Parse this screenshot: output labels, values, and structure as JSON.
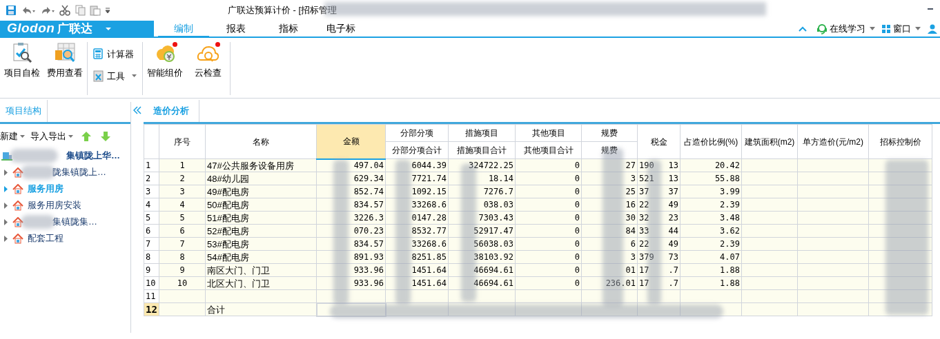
{
  "window": {
    "title": "广联达预算计价 - [招标管理"
  },
  "brand": {
    "logo": "Glodon",
    "name": "广联达"
  },
  "menu_tabs": [
    {
      "label": "编制",
      "selected": true
    },
    {
      "label": "报表",
      "selected": false
    },
    {
      "label": "指标",
      "selected": false
    },
    {
      "label": "电子标",
      "selected": false
    }
  ],
  "top_right": {
    "learning": "在线学习",
    "window_menu": "窗口"
  },
  "ribbon": [
    {
      "kind": "large",
      "items": [
        {
          "label": "项目自检",
          "notification": false
        },
        {
          "label": "费用查看",
          "notification": false
        }
      ]
    },
    {
      "kind": "small",
      "items": [
        {
          "label": "计算器",
          "dropdown": false
        },
        {
          "label": "工具",
          "dropdown": true
        }
      ]
    },
    {
      "kind": "large",
      "items": [
        {
          "label": "智能组价",
          "notification": true
        },
        {
          "label": "云检查",
          "notification": true
        }
      ]
    }
  ],
  "left_panel": {
    "tab": "项目结构",
    "toolbar": [
      "新建",
      "导入导出"
    ],
    "tree": [
      {
        "label": "集镇陇上华…",
        "kind": "root",
        "children": [
          {
            "label": "陇集镇陇上…",
            "selected": false,
            "expanded": false,
            "redacted": true
          },
          {
            "label": "服务用房",
            "selected": true,
            "expanded": false,
            "redacted": false
          },
          {
            "label": "服务用房安装",
            "selected": false,
            "expanded": false,
            "redacted": false
          },
          {
            "label": "集镇陇集…",
            "selected": false,
            "expanded": false,
            "redacted": true
          },
          {
            "label": "配套工程",
            "selected": false,
            "expanded": false,
            "redacted": false
          }
        ]
      }
    ]
  },
  "content_tab": "造价分析",
  "table": {
    "columns": [
      {
        "selected": false
      },
      {
        "label": "序号",
        "selected": false
      },
      {
        "label": "名称",
        "selected": false
      },
      {
        "label": "金额",
        "selected": true
      },
      {
        "group": "分部分项",
        "label": "分部分项合计",
        "selected": false
      },
      {
        "group": "措施项目",
        "label": "措施项目合计",
        "selected": false
      },
      {
        "group": "其他项目",
        "label": "其他项目合计",
        "selected": false
      },
      {
        "group": "规费",
        "label": "规费",
        "selected": false
      },
      {
        "label": "税金",
        "selected": false
      },
      {
        "label": "占造价比例(%)",
        "selected": false
      },
      {
        "label": "建筑面积(m2)",
        "selected": false
      },
      {
        "label": "单方造价(元/m2)",
        "selected": false
      },
      {
        "label": "招标控制价",
        "selected": false
      }
    ],
    "rows": [
      {
        "selected": false,
        "cells": [
          "1",
          "1",
          "47#公共服务设备用房",
          "497.04",
          "6044.39",
          "324722.25",
          "0",
          "27",
          [
            "190",
            "13"
          ],
          "20.42",
          "",
          "",
          ""
        ]
      },
      {
        "selected": false,
        "cells": [
          "2",
          "2",
          "48#幼儿园",
          "629.34",
          "7721.74",
          "18.14",
          "0",
          "3",
          [
            "521",
            "13"
          ],
          "55.88",
          "",
          "",
          ""
        ]
      },
      {
        "selected": false,
        "cells": [
          "3",
          "3",
          "49#配电房",
          "852.74",
          "1092.15",
          "7276.7",
          "0",
          "25",
          [
            "37",
            "37"
          ],
          "3.99",
          "",
          "",
          ""
        ]
      },
      {
        "selected": false,
        "cells": [
          "4",
          "4",
          "50#配电房",
          "834.57",
          "33268.6",
          "038.03",
          "0",
          "16",
          [
            "22",
            "49"
          ],
          "2.39",
          "",
          "",
          ""
        ]
      },
      {
        "selected": false,
        "cells": [
          "5",
          "5",
          "51#配电房",
          "3226.3",
          "0147.28",
          "7303.43",
          "0",
          "30",
          [
            "32",
            "23"
          ],
          "3.48",
          "",
          "",
          ""
        ]
      },
      {
        "selected": false,
        "cells": [
          "6",
          "6",
          "52#配电房",
          "070.23",
          "8532.77",
          "52917.47",
          "0",
          "84",
          [
            "33",
            "44"
          ],
          "3.62",
          "",
          "",
          ""
        ]
      },
      {
        "selected": false,
        "cells": [
          "7",
          "7",
          "53#配电房",
          "834.57",
          "33268.6",
          "56038.03",
          "0",
          "6",
          [
            "22",
            "49"
          ],
          "2.39",
          "",
          "",
          ""
        ]
      },
      {
        "selected": false,
        "cells": [
          "8",
          "8",
          "54#配电房",
          "891.93",
          "8251.85",
          "38103.92",
          "0",
          "3",
          [
            "379",
            "73"
          ],
          "4.07",
          "",
          "",
          ""
        ]
      },
      {
        "selected": false,
        "cells": [
          "9",
          "9",
          "南区大门、门卫",
          "933.96",
          "1451.64",
          "46694.61",
          "0",
          "01",
          [
            "17",
            ".7"
          ],
          "1.88",
          "",
          "",
          ""
        ]
      },
      {
        "selected": false,
        "cells": [
          "10",
          "10",
          "北区大门、门卫",
          "933.96",
          "1451.64",
          "46694.61",
          "0",
          "236.01",
          [
            "17",
            ".7"
          ],
          "1.88",
          "",
          "",
          ""
        ]
      },
      {
        "selected": false,
        "cells": [
          "11",
          "",
          "",
          "",
          "",
          "",
          "",
          "",
          "",
          "",
          "",
          "",
          ""
        ]
      },
      {
        "selected": true,
        "cells": [
          "12",
          "",
          "合计",
          "",
          "",
          "",
          "",
          "",
          "",
          "",
          "",
          "",
          ""
        ]
      }
    ]
  }
}
